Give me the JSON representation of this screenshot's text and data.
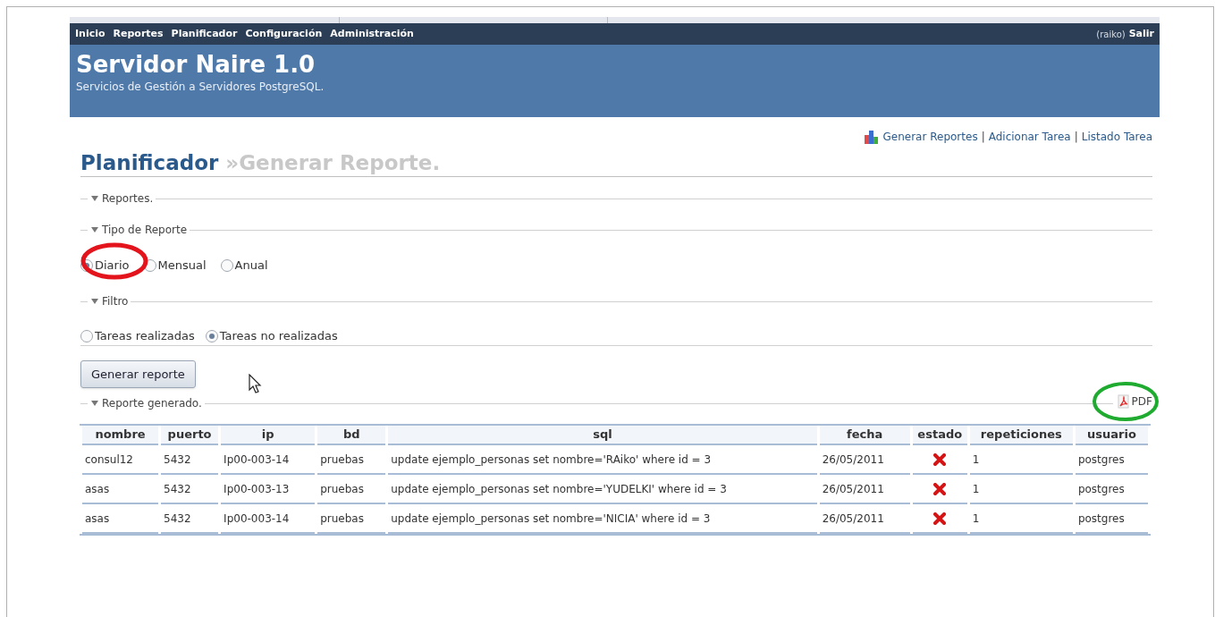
{
  "nav": {
    "items": [
      "Inicio",
      "Reportes",
      "Planificador",
      "Configuración",
      "Administración"
    ],
    "user": "(raiko)",
    "logout": "Salir"
  },
  "banner": {
    "title": "Servidor Naire 1.0",
    "subtitle": "Servicios de Gestión a Servidores PostgreSQL."
  },
  "actions": [
    "Generar Reportes",
    "Adicionar Tarea",
    "Listado Tarea"
  ],
  "actions_separator": "|",
  "page_title": {
    "section": "Planificador",
    "sub": "»Generar Reporte."
  },
  "sections": [
    {
      "label": "Reportes.",
      "expanded": true
    },
    {
      "label": "Tipo de Reporte",
      "expanded": true
    }
  ],
  "report_type": [
    {
      "label": "Diario",
      "selected": true
    },
    {
      "label": "Mensual",
      "selected": false
    },
    {
      "label": "Anual",
      "selected": false
    }
  ],
  "filter_section": {
    "label": "Filtro",
    "expanded": true
  },
  "filter": [
    {
      "label": "Tareas realizadas",
      "selected": false
    },
    {
      "label": "Tareas no realizadas",
      "selected": true
    }
  ],
  "generate_button": "Generar reporte",
  "result_section": {
    "label": "Reporte generado.",
    "expanded": true
  },
  "pdf_link": "PDF",
  "table": {
    "columns": [
      "nombre",
      "puerto",
      "ip",
      "bd",
      "sql",
      "fecha",
      "estado",
      "repeticiones",
      "usuario"
    ],
    "rows": [
      {
        "nombre": "consul12",
        "puerto": "5432",
        "ip": "Ip00-003-14",
        "bd": "pruebas",
        "sql": "update ejemplo_personas set nombre='RAiko' where id = 3",
        "fecha": "26/05/2011",
        "done": false,
        "repeticiones": "1",
        "usuario": "postgres"
      },
      {
        "nombre": "asas",
        "puerto": "5432",
        "ip": "Ip00-003-13",
        "bd": "pruebas",
        "sql": "update ejemplo_personas set nombre='YUDELKI' where id = 3",
        "fecha": "26/05/2011",
        "done": false,
        "repeticiones": "1",
        "usuario": "postgres"
      },
      {
        "nombre": "asas",
        "puerto": "5432",
        "ip": "Ip00-003-14",
        "bd": "pruebas",
        "sql": "update ejemplo_personas set nombre='NICIA' where id = 3",
        "fecha": "26/05/2011",
        "done": false,
        "repeticiones": "1",
        "usuario": "postgres"
      }
    ]
  }
}
